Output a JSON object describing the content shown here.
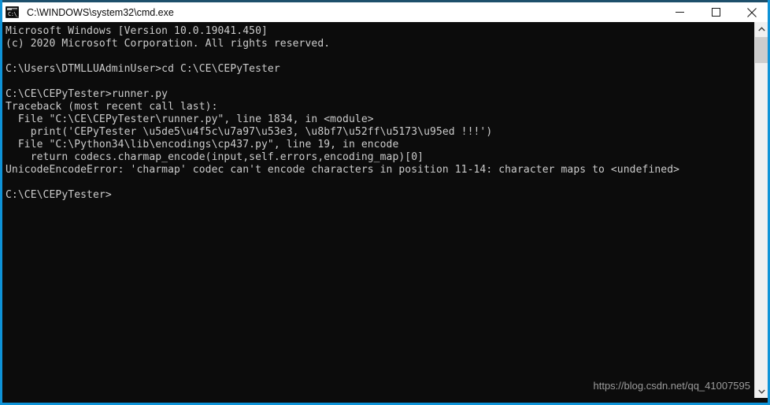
{
  "window": {
    "title": "C:\\WINDOWS\\system32\\cmd.exe",
    "icon": "cmd-console-icon",
    "icon_prompt_text": "C:\\_",
    "accent_color": "#0e93d8",
    "titlebar_top_border_color": "#1d4f6b",
    "background_color": "#0c0c0c",
    "text_color": "#cccccc"
  },
  "controls": {
    "minimize_label": "Minimize",
    "maximize_label": "Maximize",
    "close_label": "Close"
  },
  "console": {
    "lines": [
      "Microsoft Windows [Version 10.0.19041.450]",
      "(c) 2020 Microsoft Corporation. All rights reserved.",
      "",
      "C:\\Users\\DTMLLUAdminUser>cd C:\\CE\\CEPyTester",
      "",
      "C:\\CE\\CEPyTester>runner.py",
      "Traceback (most recent call last):",
      "  File \"C:\\CE\\CEPyTester\\runner.py\", line 1834, in <module>",
      "    print('CEPyTester \\u5de5\\u4f5c\\u7a97\\u53e3, \\u8bf7\\u52ff\\u5173\\u95ed !!!')",
      "  File \"C:\\Python34\\lib\\encodings\\cp437.py\", line 19, in encode",
      "    return codecs.charmap_encode(input,self.errors,encoding_map)[0]",
      "UnicodeEncodeError: 'charmap' codec can't encode characters in position 11-14: character maps to <undefined>",
      "",
      "C:\\CE\\CEPyTester>"
    ]
  },
  "watermark": {
    "text": "https://blog.csdn.net/qq_41007595"
  },
  "scrollbar": {
    "up_arrow": "chevron-up-icon",
    "down_arrow": "chevron-down-icon"
  }
}
